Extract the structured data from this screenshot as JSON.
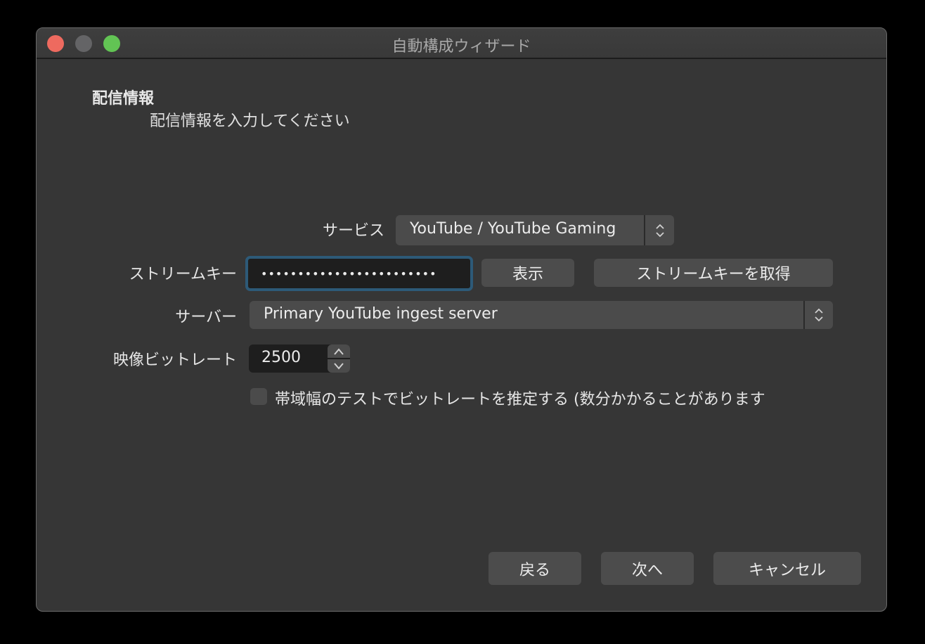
{
  "window": {
    "title": "自動構成ウィザード"
  },
  "page": {
    "heading": "配信情報",
    "subheading": "配信情報を入力してください"
  },
  "form": {
    "service": {
      "label": "サービス",
      "value": "YouTube / YouTube Gaming"
    },
    "stream_key": {
      "label": "ストリームキー",
      "value": "••••••••••••••••••••••••",
      "show_button": "表示",
      "get_key_button": "ストリームキーを取得"
    },
    "server": {
      "label": "サーバー",
      "value": "Primary YouTube ingest server"
    },
    "bitrate": {
      "label": "映像ビットレート",
      "value": "2500"
    },
    "bandwidth_test": {
      "checked": false,
      "label": "帯域幅のテストでビットレートを推定する (数分かかることがあります"
    }
  },
  "footer": {
    "back": "戻る",
    "next": "次へ",
    "cancel": "キャンセル"
  },
  "colors": {
    "focus_ring": "#2d5a78",
    "close": "#ee6a5f",
    "minimize": "#646466",
    "zoom": "#62c454"
  }
}
